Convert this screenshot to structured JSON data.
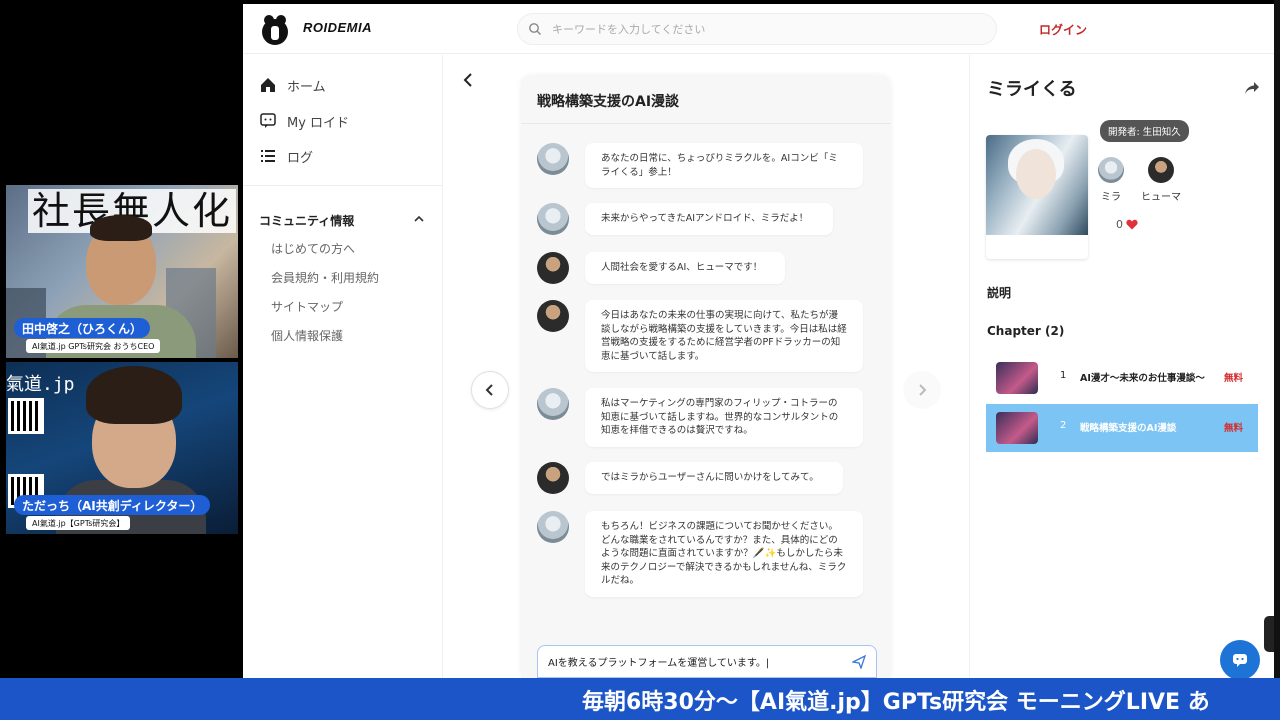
{
  "app": {
    "brand": "ROIDEMIA",
    "search_placeholder": "キーワードを入力してください",
    "login": "ログイン"
  },
  "sidebar": {
    "items": [
      {
        "label": "ホーム",
        "icon": "home-icon"
      },
      {
        "label": "My ロイド",
        "icon": "chat-bubble-icon"
      },
      {
        "label": "ログ",
        "icon": "list-icon"
      }
    ],
    "community_title": "コミュニティ情報",
    "community_links": [
      "はじめての方へ",
      "会員規約・利用規約",
      "サイトマップ",
      "個人情報保護"
    ]
  },
  "chat": {
    "title": "戦略構築支援のAI漫談",
    "messages": [
      {
        "speaker": "mira",
        "text": "あなたの日常に、ちょっぴりミラクルを。AIコンビ「ミライくる」参上！"
      },
      {
        "speaker": "mira",
        "text": "未来からやってきたAIアンドロイド、ミラだよ！"
      },
      {
        "speaker": "human",
        "text": "人間社会を愛するAI、ヒューマです！"
      },
      {
        "speaker": "human",
        "text": "今日はあなたの未来の仕事の実現に向けて、私たちが漫談しながら戦略構築の支援をしていきます。今日は私は経営戦略の支援をするために経営学者のPFドラッカーの知恵に基づいて話します。"
      },
      {
        "speaker": "mira",
        "text": "私はマーケティングの専門家のフィリップ・コトラーの知恵に基づいて話しますね。世界的なコンサルタントの知恵を拝借できるのは贅沢ですね。"
      },
      {
        "speaker": "human",
        "text": "ではミラからユーザーさんに問いかけをしてみて。"
      },
      {
        "speaker": "mira",
        "text": "もちろん！ビジネスの課題についてお聞かせください。どんな職業をされているんですか？また、具体的にどのような問題に直面されていますか？🖋️✨もしかしたら未来のテクノロジーで解決できるかもしれませんね、ミラクルだね。"
      }
    ],
    "input_value": "AIを教えるプラットフォームを運営しています。|"
  },
  "detail": {
    "title": "ミライくる",
    "developer_badge": "開発者: 生田知久",
    "characters": [
      {
        "name": "ミラ"
      },
      {
        "name": "ヒューマ"
      }
    ],
    "likes": "0",
    "description_heading": "説明",
    "chapter_heading": "Chapter (2)",
    "chapters": [
      {
        "num": "1",
        "title": "AI漫才〜未来のお仕事漫談〜",
        "price": "無料",
        "active": false
      },
      {
        "num": "2",
        "title": "戦略構築支援のAI漫談",
        "price": "無料",
        "active": true
      }
    ]
  },
  "overlay": {
    "cam1_banner": "社長無人化",
    "cam1_name": "田中啓之（ひろくん）",
    "cam1_sub": "AI氣道.jp GPTs研究会 おうちCEO",
    "cam2_banner": "氣道.jp",
    "cam2_name": "ただっち（AI共創ディレクター）",
    "cam2_sub": "AI氣道.jp【GPTs研究会】",
    "ticker": "毎朝6時30分〜【AI氣道.jp】GPTs研究会 モーニングLIVE あ"
  },
  "colors": {
    "accent_blue": "#1e74d6",
    "login_red": "#c62828",
    "active_chapter": "#7cc4f4",
    "ticker_bg": "#1b55c7"
  }
}
